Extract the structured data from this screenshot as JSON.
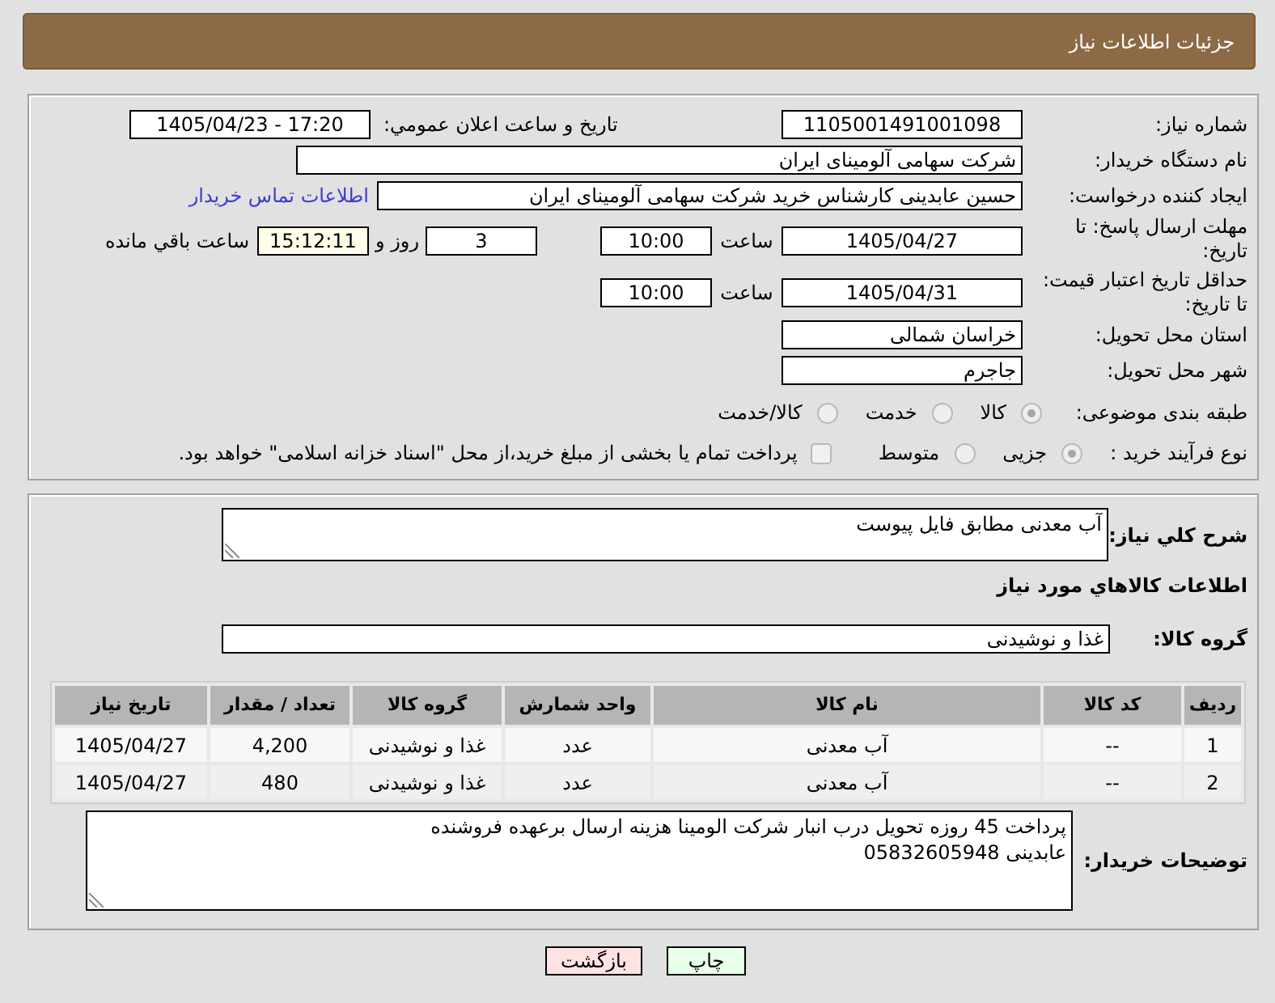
{
  "header": {
    "title": "جزئیات اطلاعات نیاز"
  },
  "details": {
    "need_number": {
      "label": "شماره نیاز:",
      "value": "1105001491001098"
    },
    "announcement": {
      "label": "تاریخ و ساعت اعلان عمومي:",
      "value": "1405/04/23 - 17:20"
    },
    "buyer_organization": {
      "label": "نام دستگاه خریدار:",
      "value": "شرکت سهامی آلومینای ایران"
    },
    "requester": {
      "label": "ایجاد کننده درخواست:",
      "value": "حسین عابدینی کارشناس خرید شرکت سهامی آلومینای ایران",
      "contact_link": "اطلاعات تماس خریدار"
    },
    "response_deadline": {
      "label": "مهلت ارسال پاسخ: تا تاریخ:",
      "date": "1405/04/27",
      "time_label": "ساعت",
      "time": "10:00",
      "days": "3",
      "days_label": "روز و",
      "remaining_time": "15:12:11",
      "remaining_label": "ساعت باقي مانده"
    },
    "price_validity": {
      "label": "حداقل تاریخ اعتبار قیمت: تا تاریخ:",
      "date": "1405/04/31",
      "time_label": "ساعت",
      "time": "10:00"
    },
    "delivery_province": {
      "label": "استان محل تحویل:",
      "value": "خراسان شمالی"
    },
    "delivery_city": {
      "label": "شهر محل تحویل:",
      "value": "جاجرم"
    },
    "subject_category": {
      "label": "طبقه بندی موضوعی:",
      "options": [
        {
          "label": "کالا",
          "selected": true
        },
        {
          "label": "خدمت",
          "selected": false
        },
        {
          "label": "کالا/خدمت",
          "selected": false
        }
      ]
    },
    "purchase_process": {
      "label": "نوع فرآیند خرید :",
      "options": [
        {
          "label": "جزیی",
          "selected": true
        },
        {
          "label": "متوسط",
          "selected": false
        }
      ],
      "treasury_payment": {
        "label": "پرداخت تمام یا بخشی از مبلغ خرید،از محل \"اسناد خزانه اسلامی\" خواهد بود.",
        "checked": false
      }
    }
  },
  "items": {
    "description": {
      "label": "شرح کلي نیاز:",
      "value": "آب معدنی مطابق فایل پیوست"
    },
    "section_title": "اطلاعات کالاهاي مورد نیاز",
    "goods_group": {
      "label": "گروه کالا:",
      "value": "غذا و نوشیدنی"
    },
    "table": {
      "columns": [
        "ردیف",
        "کد کالا",
        "نام کالا",
        "واحد شمارش",
        "گروه کالا",
        "تعداد / مقدار",
        "تاریخ نیاز"
      ],
      "rows": [
        [
          "1",
          "--",
          "آب معدنی",
          "عدد",
          "غذا و نوشیدنی",
          "4,200",
          "1405/04/27"
        ],
        [
          "2",
          "--",
          "آب معدنی",
          "عدد",
          "غذا و نوشیدنی",
          "480",
          "1405/04/27"
        ]
      ]
    },
    "buyer_notes": {
      "label": "توضیحات خریدار:",
      "value": "پرداخت 45 روزه تحویل درب انبار شرکت الومینا هزینه ارسال برعهده فروشنده\nعابدینی 05832605948"
    }
  },
  "buttons": [
    {
      "kind": "print",
      "label": "چاپ"
    },
    {
      "kind": "back",
      "label": "بازگشت"
    }
  ]
}
